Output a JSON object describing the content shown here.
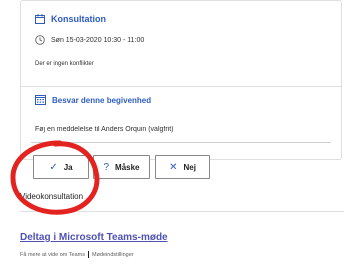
{
  "event": {
    "title": "Konsultation",
    "datetime": "Søn 15-03-2020 10:30 - 11:00",
    "conflicts": "Der er ingen konflikter"
  },
  "respond": {
    "title": "Besvar denne begivenhed",
    "message_placeholder": "Føj en meddelelse til Anders Orquin (valgfrit)"
  },
  "buttons": {
    "yes": "Ja",
    "maybe": "Måske",
    "no": "Nej"
  },
  "meeting": {
    "location": "Videokonsultation",
    "join_link": "Deltag i Microsoft Teams-møde",
    "learn_more": "Få mere at vide om Teams",
    "options": "Mødeindstillinger"
  },
  "colors": {
    "accent": "#2f5dbd",
    "teams": "#4f52b2",
    "annotation": "#e3231f"
  },
  "icons": [
    "calendar-icon",
    "clock-icon",
    "calendar-list-icon",
    "check-icon",
    "question-icon",
    "cross-icon"
  ]
}
